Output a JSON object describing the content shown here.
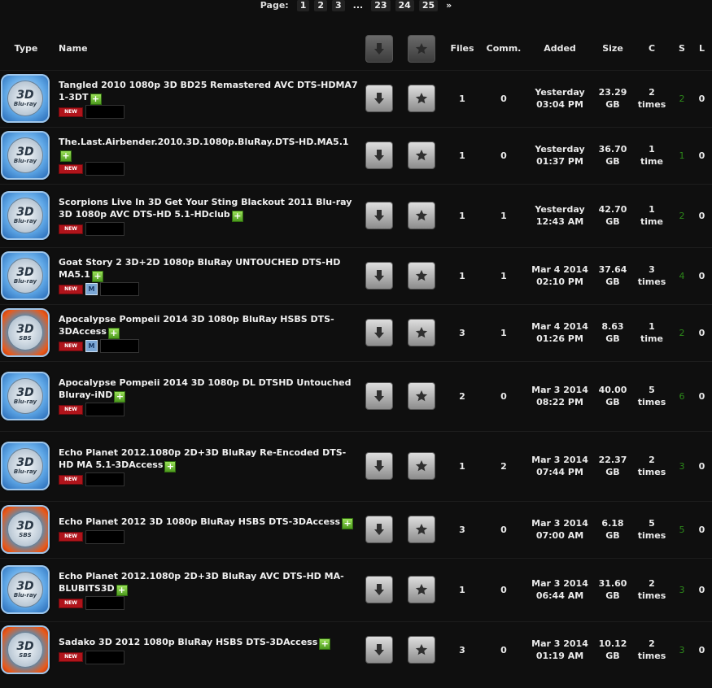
{
  "pager": {
    "label": "Page:",
    "pages": [
      "1",
      "2",
      "3",
      "...",
      "23",
      "24",
      "25",
      "»"
    ]
  },
  "columns": {
    "type": "Type",
    "name": "Name",
    "files": "Files",
    "comm": "Comm.",
    "added": "Added",
    "size": "Size",
    "c": "C",
    "s": "S",
    "l": "L"
  },
  "icons": {
    "download": "download-arrow-icon",
    "favorite": "star-icon",
    "bluray": "3d-bluray-icon",
    "sbs": "3d-sbs-icon"
  },
  "colors": {
    "seed": "#2d8a1a",
    "new_badge": "#b0141b"
  },
  "torrents": [
    {
      "icon": "bluray",
      "icon_t1": "3D",
      "icon_t2": "Blu-ray",
      "name": "Tangled 2010 1080p 3D BD25 Remastered AVC DTS-HDMA7 1-3DT",
      "new": "NEW",
      "m": "",
      "files": "1",
      "comm": "0",
      "added_d": "Yesterday",
      "added_t": "03:04 PM",
      "size_v": "23.29",
      "size_u": "GB",
      "c_v": "2",
      "c_u": "times",
      "s": "2",
      "l": "0"
    },
    {
      "icon": "bluray",
      "icon_t1": "3D",
      "icon_t2": "Blu-ray",
      "name": "The.Last.Airbender.2010.3D.1080p.BluRay.DTS-HD.MA5.1",
      "new": "NEW",
      "m": "",
      "files": "1",
      "comm": "0",
      "added_d": "Yesterday",
      "added_t": "01:37 PM",
      "size_v": "36.70",
      "size_u": "GB",
      "c_v": "1",
      "c_u": "time",
      "s": "1",
      "l": "0"
    },
    {
      "icon": "bluray",
      "icon_t1": "3D",
      "icon_t2": "Blu-ray",
      "name": "Scorpions Live In 3D Get Your Sting Blackout 2011 Blu-ray 3D 1080p AVC DTS-HD 5.1-HDclub",
      "new": "NEW",
      "m": "",
      "files": "1",
      "comm": "1",
      "added_d": "Yesterday",
      "added_t": "12:43 AM",
      "size_v": "42.70",
      "size_u": "GB",
      "c_v": "1",
      "c_u": "time",
      "s": "2",
      "l": "0"
    },
    {
      "icon": "bluray",
      "icon_t1": "3D",
      "icon_t2": "Blu-ray",
      "name": "Goat Story 2 3D+2D 1080p BluRay UNTOUCHED DTS-HD MA5.1",
      "new": "NEW",
      "m": "M",
      "files": "1",
      "comm": "1",
      "added_d": "Mar 4 2014",
      "added_t": "02:10 PM",
      "size_v": "37.64",
      "size_u": "GB",
      "c_v": "3",
      "c_u": "times",
      "s": "4",
      "l": "0"
    },
    {
      "icon": "sbs",
      "icon_t1": "3D",
      "icon_t2": "SBS",
      "name": "Apocalypse Pompeii 2014 3D 1080p BluRay HSBS DTS-3DAccess",
      "new": "NEW",
      "m": "M",
      "files": "3",
      "comm": "1",
      "added_d": "Mar 4 2014",
      "added_t": "01:26 PM",
      "size_v": "8.63",
      "size_u": "GB",
      "c_v": "1",
      "c_u": "time",
      "s": "2",
      "l": "0"
    },
    {
      "icon": "bluray",
      "icon_t1": "3D",
      "icon_t2": "Blu-ray",
      "name": "Apocalypse Pompeii 2014 3D 1080p DL DTSHD Untouched Bluray-iND",
      "new": "NEW",
      "m": "",
      "files": "2",
      "comm": "0",
      "added_d": "Mar 3 2014",
      "added_t": "08:22 PM",
      "size_v": "40.00",
      "size_u": "GB",
      "c_v": "5",
      "c_u": "times",
      "s": "6",
      "l": "0"
    },
    {
      "icon": "bluray",
      "icon_t1": "3D",
      "icon_t2": "Blu-ray",
      "name": "Echo Planet 2012.1080p 2D+3D BluRay Re-Encoded DTS-HD MA 5.1-3DAccess",
      "new": "NEW",
      "m": "",
      "files": "1",
      "comm": "2",
      "added_d": "Mar 3 2014",
      "added_t": "07:44 PM",
      "size_v": "22.37",
      "size_u": "GB",
      "c_v": "2",
      "c_u": "times",
      "s": "3",
      "l": "0"
    },
    {
      "icon": "sbs",
      "icon_t1": "3D",
      "icon_t2": "SBS",
      "name": "Echo Planet 2012 3D 1080p BluRay HSBS DTS-3DAccess",
      "new": "NEW",
      "m": "",
      "files": "3",
      "comm": "0",
      "added_d": "Mar 3 2014",
      "added_t": "07:00 AM",
      "size_v": "6.18",
      "size_u": "GB",
      "c_v": "5",
      "c_u": "times",
      "s": "5",
      "l": "0"
    },
    {
      "icon": "bluray",
      "icon_t1": "3D",
      "icon_t2": "Blu-ray",
      "name": "Echo Planet 2012.1080p 2D+3D BluRay AVC DTS-HD MA-BLUBITS3D",
      "new": "NEW",
      "m": "",
      "files": "1",
      "comm": "0",
      "added_d": "Mar 3 2014",
      "added_t": "06:44 AM",
      "size_v": "31.60",
      "size_u": "GB",
      "c_v": "2",
      "c_u": "times",
      "s": "3",
      "l": "0"
    },
    {
      "icon": "sbs",
      "icon_t1": "3D",
      "icon_t2": "SBS",
      "name": "Sadako 3D 2012 1080p BluRay HSBS DTS-3DAccess",
      "new": "NEW",
      "m": "",
      "files": "3",
      "comm": "0",
      "added_d": "Mar 3 2014",
      "added_t": "01:19 AM",
      "size_v": "10.12",
      "size_u": "GB",
      "c_v": "2",
      "c_u": "times",
      "s": "3",
      "l": "0"
    }
  ]
}
